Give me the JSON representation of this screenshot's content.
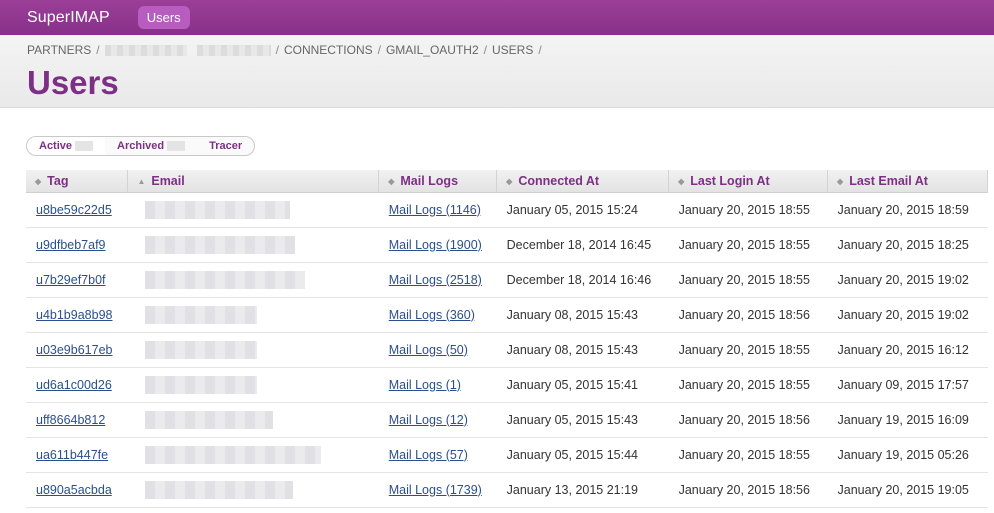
{
  "app": {
    "brand": "SuperIMAP",
    "nav_active": "Users"
  },
  "breadcrumb": [
    "PARTNERS",
    "CONNECTIONS",
    "GMAIL_OAUTH2",
    "USERS"
  ],
  "page_title": "Users",
  "filters": [
    {
      "label": "Active"
    },
    {
      "label": "Archived"
    },
    {
      "label": "Tracer"
    }
  ],
  "table": {
    "columns": [
      "Tag",
      "Email",
      "Mail Logs",
      "Connected At",
      "Last Login At",
      "Last Email At"
    ],
    "sorted_column": "Email",
    "rows": [
      {
        "tag": "u8be59c22d5",
        "mail_logs": "Mail Logs (1146)",
        "connected": "January 05, 2015 15:24",
        "last_login": "January 20, 2015 18:55",
        "last_email": "January 20, 2015 18:59"
      },
      {
        "tag": "u9dfbeb7af9",
        "mail_logs": "Mail Logs (1900)",
        "connected": "December 18, 2014 16:45",
        "last_login": "January 20, 2015 18:55",
        "last_email": "January 20, 2015 18:25"
      },
      {
        "tag": "u7b29ef7b0f",
        "mail_logs": "Mail Logs (2518)",
        "connected": "December 18, 2014 16:46",
        "last_login": "January 20, 2015 18:55",
        "last_email": "January 20, 2015 19:02"
      },
      {
        "tag": "u4b1b9a8b98",
        "mail_logs": "Mail Logs (360)",
        "connected": "January 08, 2015 15:43",
        "last_login": "January 20, 2015 18:56",
        "last_email": "January 20, 2015 19:02"
      },
      {
        "tag": "u03e9b617eb",
        "mail_logs": "Mail Logs (50)",
        "connected": "January 08, 2015 15:43",
        "last_login": "January 20, 2015 18:55",
        "last_email": "January 20, 2015 16:12"
      },
      {
        "tag": "ud6a1c00d26",
        "mail_logs": "Mail Logs (1)",
        "connected": "January 05, 2015 15:41",
        "last_login": "January 20, 2015 18:55",
        "last_email": "January 09, 2015 17:57"
      },
      {
        "tag": "uff8664b812",
        "mail_logs": "Mail Logs (12)",
        "connected": "January 05, 2015 15:43",
        "last_login": "January 20, 2015 18:56",
        "last_email": "January 19, 2015 16:09"
      },
      {
        "tag": "ua611b447fe",
        "mail_logs": "Mail Logs (57)",
        "connected": "January 05, 2015 15:44",
        "last_login": "January 20, 2015 18:55",
        "last_email": "January 19, 2015 05:26"
      },
      {
        "tag": "u890a5acbda",
        "mail_logs": "Mail Logs (1739)",
        "connected": "January 13, 2015 21:19",
        "last_login": "January 20, 2015 18:56",
        "last_email": "January 20, 2015 19:05"
      }
    ]
  }
}
